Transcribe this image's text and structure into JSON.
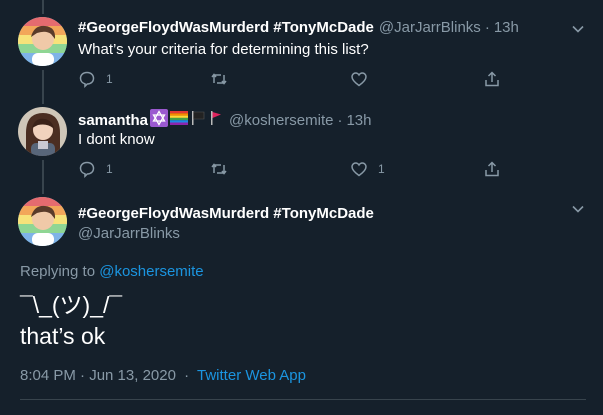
{
  "tweets": [
    {
      "name": "#GeorgeFloydWasMurderd #TonyMcDade",
      "handle": "@JarJarrBlinks",
      "time": "13h",
      "text": "What’s your criteria for determining this list?",
      "reply_count": "1",
      "retweet_count": "",
      "like_count": ""
    },
    {
      "name": "samantha",
      "handle": "@koshersemite",
      "time": "13h",
      "text": "I dont know",
      "reply_count": "1",
      "retweet_count": "",
      "like_count": "1"
    }
  ],
  "main_tweet": {
    "name": "#GeorgeFloydWasMurderd #TonyMcDade",
    "handle": "@JarJarrBlinks",
    "replying_to_label": "Replying to",
    "replying_to_handle": "@koshersemite",
    "line1": "¯\\_(ツ)_/¯",
    "line2": "that’s ok",
    "timestamp": "8:04 PM · Jun 13, 2020",
    "separator": "·",
    "source": "Twitter Web App"
  },
  "separator": "·",
  "colors": {
    "background": "#15202b",
    "text": "#ffffff",
    "secondary": "#8899a6",
    "link": "#1b95e0",
    "divider": "#38444d"
  },
  "icons": [
    "reply-icon",
    "retweet-icon",
    "like-icon",
    "share-icon",
    "chevron-down-icon",
    "star-of-david-emoji",
    "rainbow-flag-emoji",
    "black-flag-emoji",
    "red-flag-emoji"
  ]
}
